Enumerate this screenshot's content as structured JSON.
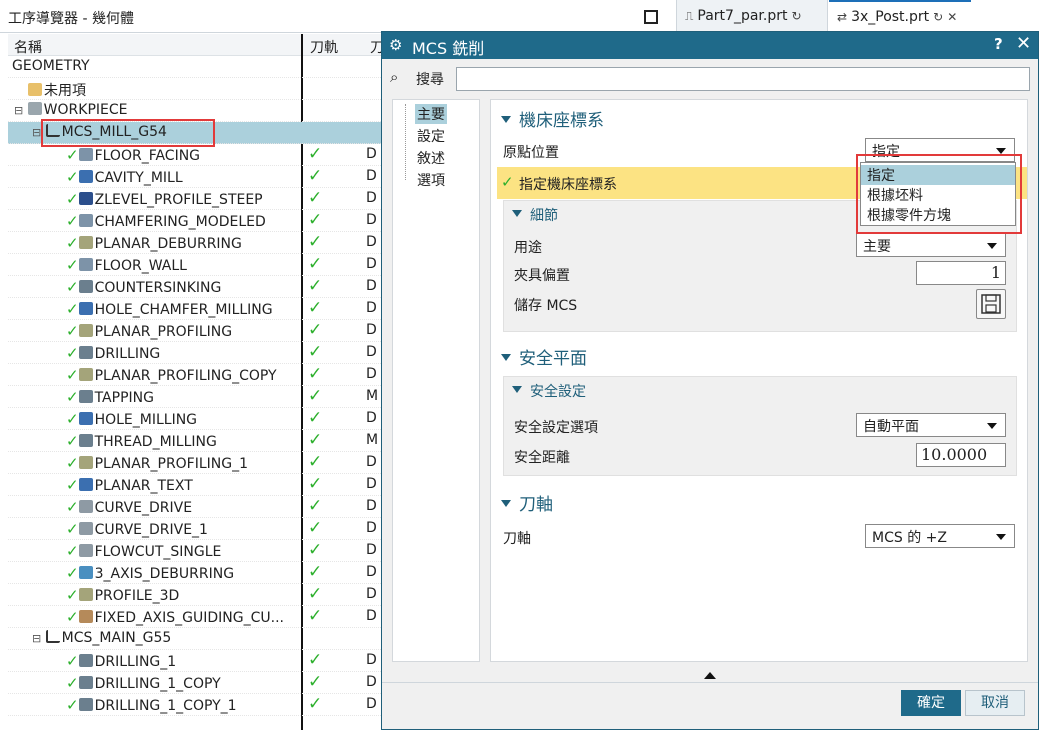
{
  "top": {
    "nav_title": "工序導覽器 - 幾何體",
    "tabs": [
      {
        "label": "Part7_par.prt"
      },
      {
        "label": "3x_Post.prt"
      }
    ]
  },
  "tree": {
    "headers": [
      "名稱",
      "刀軌",
      "刀"
    ],
    "rows": [
      {
        "name": "GEOMETRY",
        "check": "",
        "col3": ""
      },
      {
        "name": "未用項",
        "check": "",
        "col3": ""
      },
      {
        "name": "WORKPIECE",
        "check": "",
        "col3": ""
      },
      {
        "name": "MCS_MILL_G54",
        "check": "",
        "col3": ""
      },
      {
        "name": "FLOOR_FACING",
        "check": "✓",
        "col3": "D"
      },
      {
        "name": "CAVITY_MILL",
        "check": "✓",
        "col3": "D"
      },
      {
        "name": "ZLEVEL_PROFILE_STEEP",
        "check": "✓",
        "col3": "D"
      },
      {
        "name": "CHAMFERING_MODELED",
        "check": "✓",
        "col3": "D"
      },
      {
        "name": "PLANAR_DEBURRING",
        "check": "✓",
        "col3": "D"
      },
      {
        "name": "FLOOR_WALL",
        "check": "✓",
        "col3": "D"
      },
      {
        "name": "COUNTERSINKING",
        "check": "✓",
        "col3": "D"
      },
      {
        "name": "HOLE_CHAMFER_MILLING",
        "check": "✓",
        "col3": "D"
      },
      {
        "name": "PLANAR_PROFILING",
        "check": "✓",
        "col3": "D"
      },
      {
        "name": "DRILLING",
        "check": "✓",
        "col3": "D"
      },
      {
        "name": "PLANAR_PROFILING_COPY",
        "check": "✓",
        "col3": "D"
      },
      {
        "name": "TAPPING",
        "check": "✓",
        "col3": "M"
      },
      {
        "name": "HOLE_MILLING",
        "check": "✓",
        "col3": "D"
      },
      {
        "name": "THREAD_MILLING",
        "check": "✓",
        "col3": "M"
      },
      {
        "name": "PLANAR_PROFILING_1",
        "check": "✓",
        "col3": "D"
      },
      {
        "name": "PLANAR_TEXT",
        "check": "✓",
        "col3": "D"
      },
      {
        "name": "CURVE_DRIVE",
        "check": "✓",
        "col3": "D"
      },
      {
        "name": "CURVE_DRIVE_1",
        "check": "✓",
        "col3": "D"
      },
      {
        "name": "FLOWCUT_SINGLE",
        "check": "✓",
        "col3": "D"
      },
      {
        "name": "3_AXIS_DEBURRING",
        "check": "✓",
        "col3": "D"
      },
      {
        "name": "PROFILE_3D",
        "check": "✓",
        "col3": "D"
      },
      {
        "name": "FIXED_AXIS_GUIDING_CU...",
        "check": "✓",
        "col3": "D"
      },
      {
        "name": "MCS_MAIN_G55",
        "check": "",
        "col3": ""
      },
      {
        "name": "DRILLING_1",
        "check": "✓",
        "col3": "D"
      },
      {
        "name": "DRILLING_1_COPY",
        "check": "✓",
        "col3": "D"
      },
      {
        "name": "DRILLING_1_COPY_1",
        "check": "✓",
        "col3": "D"
      }
    ]
  },
  "dialog": {
    "title": "MCS 銑削",
    "help": "?",
    "close": "✕",
    "search_label": "搜尋",
    "search_value": "",
    "nav": [
      "主要",
      "設定",
      "敘述",
      "選項"
    ],
    "mcs": {
      "header": "機床座標系",
      "origin_label": "原點位置",
      "origin_value": "指定",
      "specify_label": "指定機床座標系",
      "dropdown_options": [
        "指定",
        "根據坯料",
        "根據零件方塊"
      ],
      "details_header": "細節",
      "purpose_label": "用途",
      "purpose_value": "主要",
      "fixture_label": "夾具偏置",
      "fixture_value": "1",
      "save_label": "儲存 MCS"
    },
    "safety": {
      "header": "安全平面",
      "sub_header": "安全設定",
      "option_label": "安全設定選項",
      "option_value": "自動平面",
      "distance_label": "安全距離",
      "distance_value": "10.0000"
    },
    "axis": {
      "header": "刀軸",
      "label": "刀軸",
      "value": "MCS 的 +Z"
    },
    "ok": "確定",
    "cancel": "取消"
  },
  "colors": {
    "accent": "#1f6a8a",
    "selection": "#abd0dc",
    "highlight": "#fce383",
    "check": "#2db02d",
    "annotation": "#e23a3a"
  }
}
